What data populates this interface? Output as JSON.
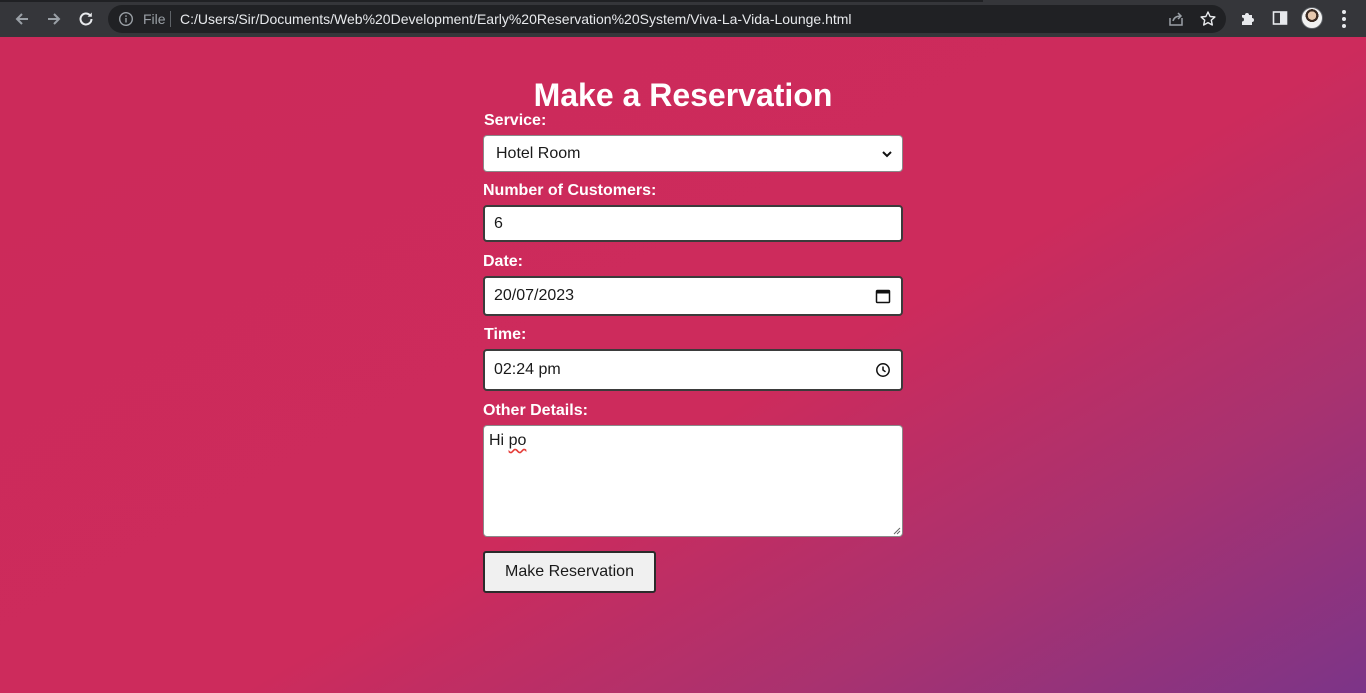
{
  "browser": {
    "address_prefix": "File",
    "url": "C:/Users/Sir/Documents/Web%20Development/Early%20Reservation%20System/Viva-La-Vida-Lounge.html"
  },
  "page": {
    "title": "Make a Reservation",
    "service": {
      "label": "Service:",
      "value": "Hotel Room"
    },
    "customers": {
      "label": "Number of Customers:",
      "value": "6"
    },
    "date": {
      "label": "Date:",
      "value": "20/07/2023"
    },
    "time": {
      "label": "Time:",
      "value": "02:24 pm"
    },
    "details": {
      "label": "Other Details:",
      "value_word1": "Hi",
      "value_word2": "po"
    },
    "submit_label": "Make Reservation"
  },
  "colors": {
    "background_gradient_start": "#cc2a5a",
    "background_gradient_end": "#7c3488",
    "chrome": "#35363a",
    "omnibox": "#202124"
  },
  "icons": {
    "back": "arrow-left-icon",
    "forward": "arrow-right-icon",
    "reload": "reload-icon",
    "info": "info-icon",
    "share": "share-icon",
    "bookmark": "star-icon",
    "extensions": "puzzle-icon",
    "side_panel": "side-panel-icon",
    "menu": "kebab-menu-icon",
    "calendar": "calendar-icon",
    "clock": "clock-icon",
    "dropdown": "chevron-down-icon"
  }
}
